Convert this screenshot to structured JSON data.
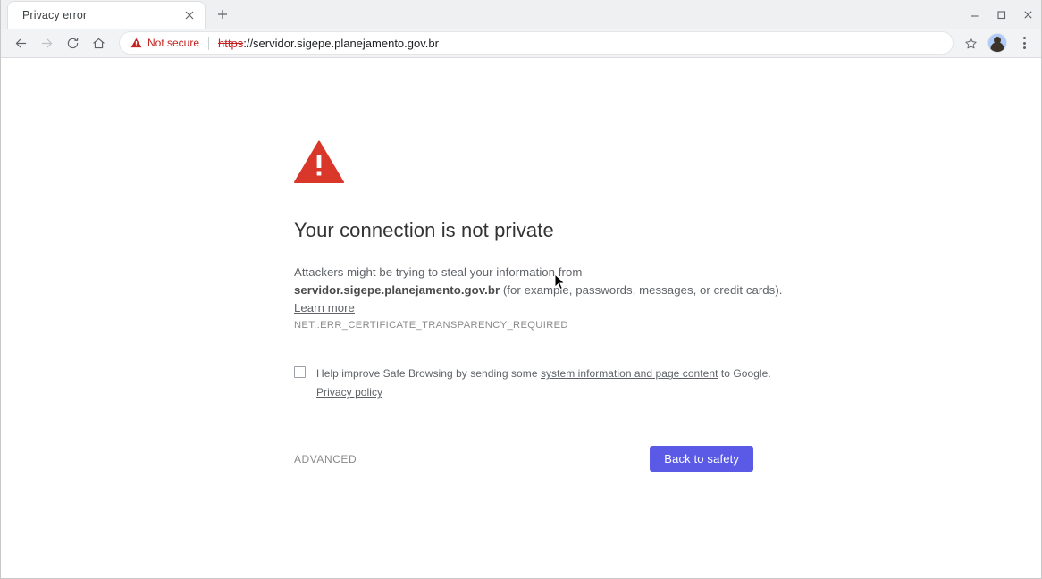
{
  "window": {
    "minimize_label": "Minimize",
    "maximize_label": "Maximize",
    "close_label": "Close"
  },
  "tabs": [
    {
      "title": "Privacy error",
      "close_label": "×"
    }
  ],
  "new_tab_label": "+",
  "toolbar": {
    "back_label": "Back",
    "forward_label": "Forward",
    "reload_label": "Reload",
    "home_label": "Home",
    "bookmark_label": "Bookmark this page",
    "profile_label": "Profile",
    "menu_label": "Customize and control Google Chrome"
  },
  "omnibox": {
    "security_status": "Not secure",
    "url_scheme": "https",
    "url_rest": "://servidor.sigepe.planejamento.gov.br"
  },
  "interstitial": {
    "icon": "warning-triangle",
    "heading": "Your connection is not private",
    "paragraph_line1": "Attackers might be trying to steal your information from",
    "host": "servidor.sigepe.planejamento.gov.br",
    "paragraph_line2_tail": " (for example, passwords, messages, or credit cards).",
    "learn_more": "Learn more",
    "error_code": "NET::ERR_CERTIFICATE_TRANSPARENCY_REQUIRED",
    "optin_prefix": "Help improve Safe Browsing by sending some ",
    "optin_link": "system information and page content",
    "optin_suffix": " to Google.",
    "privacy_policy": "Privacy policy",
    "advanced_label": "ADVANCED",
    "back_to_safety_label": "Back to safety",
    "checkbox_checked": false
  },
  "colors": {
    "warning_red": "#d93025",
    "button_blue": "#5a5ae6",
    "not_secure_red": "#c5221f",
    "heading_gray": "#333333",
    "body_gray": "#5f6368"
  }
}
